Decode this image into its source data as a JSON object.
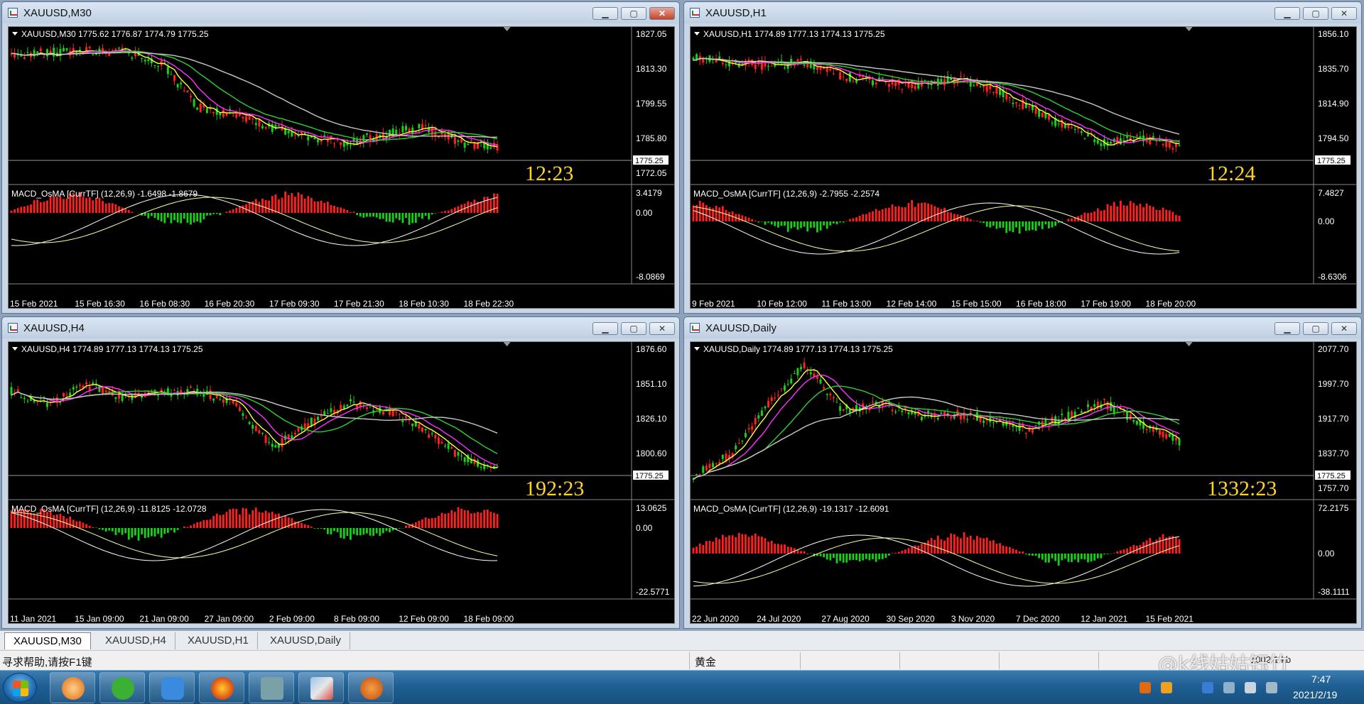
{
  "windows": [
    {
      "title": "XAUUSD,M30",
      "header": "XAUUSD,M30  1775.62 1776.87 1774.79 1775.25",
      "prices": [
        "1827.05",
        "1813.30",
        "1799.55",
        "1785.80",
        "1772.05"
      ],
      "current_price": "1775.25",
      "clock": "12:23",
      "macd_label": "MACD_OsMA [CurrTF] (12,26,9) -1.6498 -1.8679",
      "macd_ticks": [
        "3.4179",
        "0.00",
        "-8.0869"
      ],
      "dates": [
        "15 Feb 2021",
        "15 Feb 16:30",
        "16 Feb 08:30",
        "16 Feb 20:30",
        "17 Feb 09:30",
        "17 Feb 21:30",
        "18 Feb 10:30",
        "18 Feb 22:30"
      ]
    },
    {
      "title": "XAUUSD,H1",
      "header": "XAUUSD,H1  1774.89 1777.13 1774.13 1775.25",
      "prices": [
        "1856.10",
        "1835.70",
        "1814.90",
        "1794.50",
        ""
      ],
      "current_price": "1775.25",
      "clock": "12:24",
      "macd_label": "MACD_OsMA [CurrTF] (12,26,9) -2.7955 -2.2574",
      "macd_ticks": [
        "7.4827",
        "0.00",
        "-8.6306"
      ],
      "dates": [
        "9 Feb 2021",
        "10 Feb 12:00",
        "11 Feb 13:00",
        "12 Feb 14:00",
        "15 Feb 15:00",
        "16 Feb 18:00",
        "17 Feb 19:00",
        "18 Feb 20:00"
      ]
    },
    {
      "title": "XAUUSD,H4",
      "header": "XAUUSD,H4  1774.89 1777.13 1774.13 1775.25",
      "prices": [
        "1876.60",
        "1851.10",
        "1826.10",
        "1800.60",
        ""
      ],
      "current_price": "1775.25",
      "clock": "192:23",
      "macd_label": "MACD_OsMA [CurrTF] (12,26,9) -11.8125 -12.0728",
      "macd_ticks": [
        "13.0625",
        "0.00",
        "-22.5771"
      ],
      "dates": [
        "11 Jan 2021",
        "15 Jan 09:00",
        "21 Jan 09:00",
        "27 Jan 09:00",
        "2 Feb 09:00",
        "8 Feb 09:00",
        "12 Feb 09:00",
        "18 Feb 09:00"
      ]
    },
    {
      "title": "XAUUSD,Daily",
      "header": "XAUUSD,Daily  1774.89 1777.13 1774.13 1775.25",
      "prices": [
        "2077.70",
        "1997.70",
        "1917.70",
        "1837.70",
        "1757.70"
      ],
      "current_price": "1775.25",
      "clock": "1332:23",
      "macd_label": "MACD_OsMA [CurrTF] (12,26,9) -19.1317 -12.6091",
      "macd_ticks": [
        "72.2175",
        "0.00",
        "-38.1111"
      ],
      "dates": [
        "22 Jun 2020",
        "24 Jul 2020",
        "27 Aug 2020",
        "30 Sep 2020",
        "3 Nov 2020",
        "7 Dec 2020",
        "12 Jan 2021",
        "15 Feb 2021"
      ]
    }
  ],
  "tabs": [
    "XAUUSD,M30",
    "XAUUSD,H4",
    "XAUUSD,H1",
    "XAUUSD,Daily"
  ],
  "status": {
    "help": "寻求帮助,请按F1键",
    "symbol": "黄金",
    "right": "1002/1 kb"
  },
  "taskbar": {
    "time": "7:47",
    "date": "2021/2/19",
    "watermark": "@k线姑姑钰竹"
  },
  "colors": {
    "bull": "#ff2020",
    "bear": "#18d018",
    "ma_fast": "#ffff40",
    "ma_mid": "#ff30ff",
    "ma_slow": "#30d030",
    "ma_long": "#c8c8c8",
    "clock": "#ffd22e"
  }
}
